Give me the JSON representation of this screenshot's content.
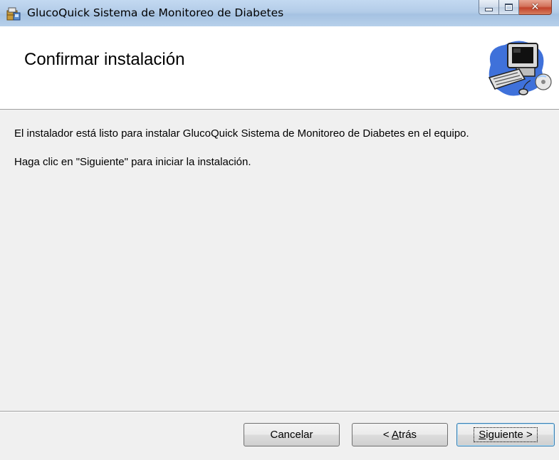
{
  "window": {
    "title": "GlucoQuick Sistema de Monitoreo de Diabetes",
    "minimize_symbol": "",
    "maximize_symbol": "",
    "close_symbol": "✕"
  },
  "banner": {
    "heading": "Confirmar instalación",
    "icon": "computer-setup-icon"
  },
  "content": {
    "line1": "El instalador está listo para instalar GlucoQuick Sistema de Monitoreo de Diabetes en el equipo.",
    "line2": "Haga clic en \"Siguiente\" para iniciar la instalación."
  },
  "buttons": {
    "cancel": "Cancelar",
    "back_prefix": "< ",
    "back_accel": "A",
    "back_rest": "trás",
    "next_accel": "S",
    "next_rest": "iguiente >"
  },
  "colors": {
    "titlebar": "#b9d1ea",
    "close_button": "#c7503a",
    "dialog_background": "#f0f0f0",
    "banner_background": "#ffffff"
  }
}
